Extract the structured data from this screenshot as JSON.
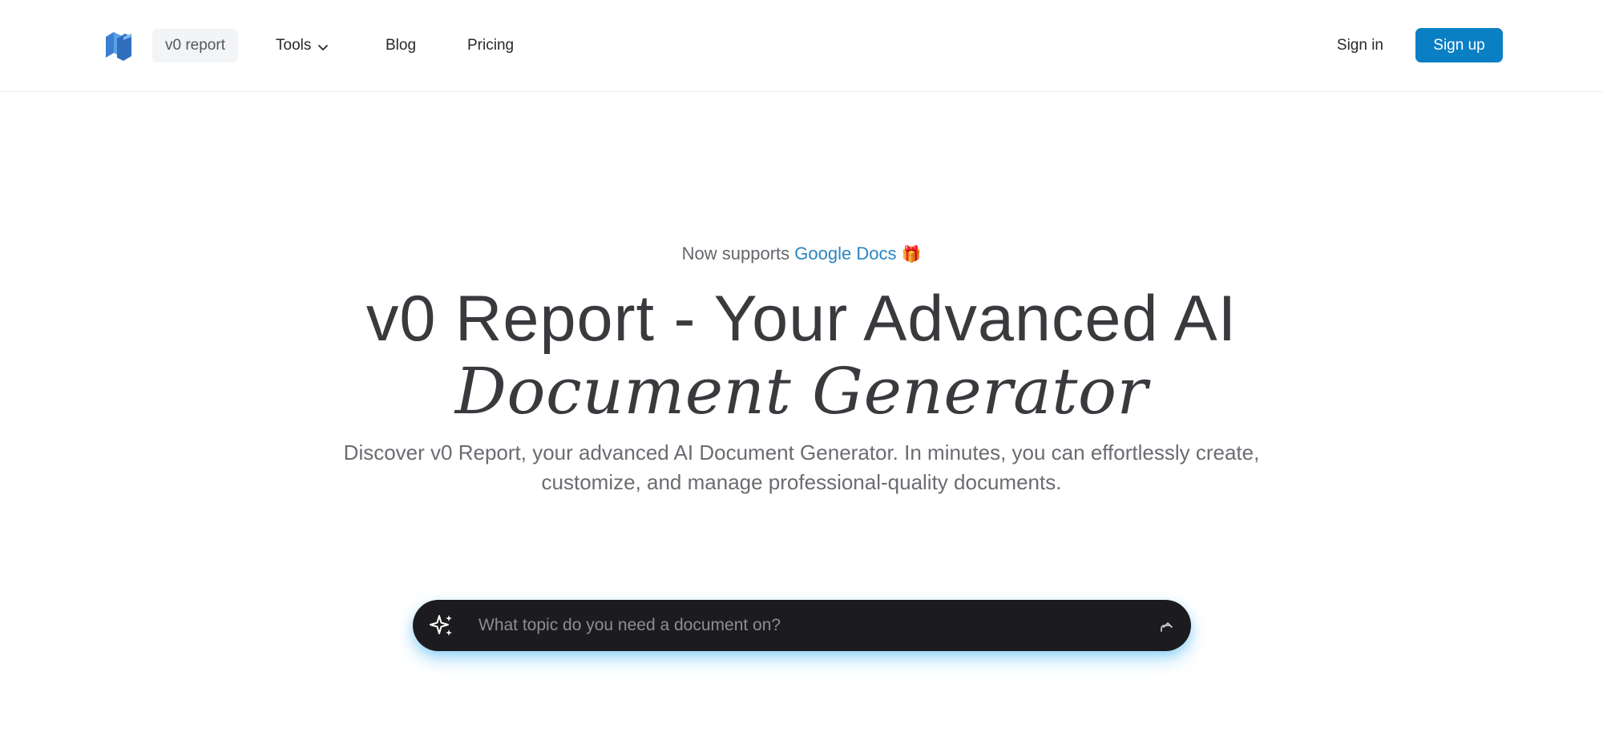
{
  "header": {
    "brand_label": "v0 report",
    "nav": {
      "tools_label": "Tools",
      "blog_label": "Blog",
      "pricing_label": "Pricing"
    },
    "signin_label": "Sign in",
    "signup_label": "Sign up"
  },
  "hero": {
    "announce_prefix": "Now supports",
    "announce_link": "Google Docs",
    "announce_emoji": "🎁",
    "title_line1": "v0 Report - Your Advanced AI",
    "title_line2": "Document Generator",
    "subtitle": "Discover v0 Report, your advanced AI Document Generator. In minutes, you can effortlessly create, customize, and manage professional-quality documents."
  },
  "prompt": {
    "placeholder": "What topic do you need a document on?",
    "value": "",
    "left_icon": "sparkle-icon",
    "submit_icon": "submit-arrow-icon"
  },
  "colors": {
    "accent": "#0a7fc4",
    "link": "#2a85c0",
    "prompt_bg": "#1c1c1f",
    "glow": "#46b4f5"
  }
}
